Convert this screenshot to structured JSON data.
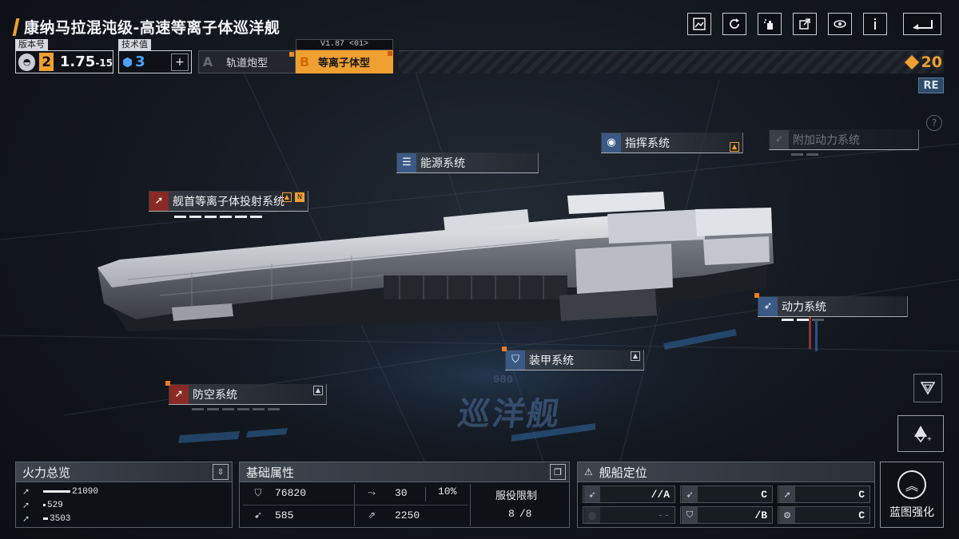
{
  "header": {
    "title": "康纳马拉混沌级-高速等离子体巡洋舰",
    "icons": [
      "gallery-icon",
      "refresh-icon",
      "paint-spray-icon",
      "share-icon",
      "view-eye-icon",
      "info-icon",
      "back-icon"
    ]
  },
  "version": {
    "label": "版本号",
    "number": "2",
    "value_main": "1.75",
    "value_sep": "-",
    "value_sub": "15"
  },
  "tech": {
    "label": "技术值",
    "value": "3",
    "plus": "+"
  },
  "variants": [
    {
      "letter": "A",
      "name": "轨道炮型",
      "active": false
    },
    {
      "letter": "B",
      "name": "等离子体型",
      "active": true,
      "tag": "V1.87 <01>"
    }
  ],
  "currency": {
    "value": "20",
    "color": "#f0a030"
  },
  "re_badge": "RE",
  "help": "?",
  "systems": {
    "command": "指挥系统",
    "aux_power": "附加动力系统",
    "energy": "能源系统",
    "bow_plasma": "舰首等离子体投射系统",
    "power": "动力系统",
    "armor": "装甲系统",
    "air_defense": "防空系统"
  },
  "ghost": {
    "number": "980",
    "text": "巡洋舰"
  },
  "firepower": {
    "title": "火力总览",
    "rows": [
      {
        "icon": "missile-icon",
        "value": "21090",
        "fraction": 1.0
      },
      {
        "icon": "missile-icon",
        "value": "529",
        "fraction": 0.03
      },
      {
        "icon": "missile-icon",
        "value": "3503",
        "fraction": 0.17
      }
    ]
  },
  "attributes": {
    "title": "基础属性",
    "hp": "76820",
    "armor": "585",
    "evasion": "30",
    "evasion_pct": "10%",
    "speed": "2250",
    "service_label": "服役限制",
    "service_value": "8",
    "service_max": "/8"
  },
  "positioning": {
    "title": "舰船定位",
    "cells": [
      {
        "icon": "strike-icon",
        "grade": "//A",
        "dim": false
      },
      {
        "icon": "target-icon",
        "grade": "--",
        "dim": true
      },
      {
        "icon": "strike-icon",
        "grade": "C",
        "dim": false
      },
      {
        "icon": "shield-icon",
        "grade": "/B",
        "dim": false
      },
      {
        "icon": "antiair-icon",
        "grade": "C",
        "dim": false
      },
      {
        "icon": "gear-icon",
        "grade": "C",
        "dim": false
      }
    ]
  },
  "blueprint": {
    "label": "蓝图强化"
  },
  "colors": {
    "accent": "#f0a030",
    "panel_blue": "#3a5a85",
    "panel_red": "#8a2a24",
    "tech_blue": "#4fa0ff"
  }
}
